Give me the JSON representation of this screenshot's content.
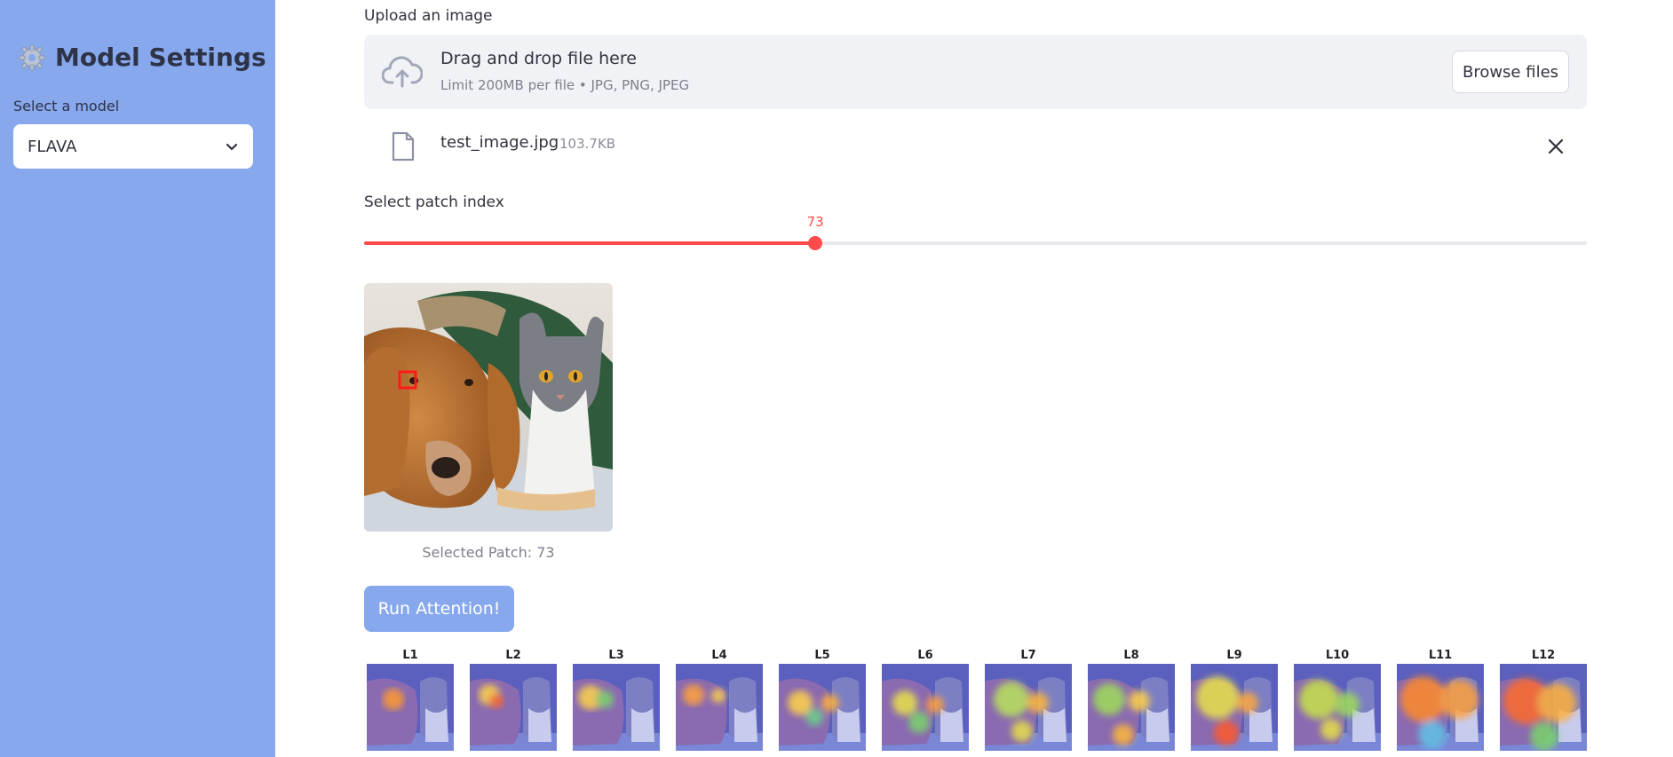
{
  "sidebar": {
    "title": "Model Settings",
    "title_icon": "gear-icon",
    "select_label": "Select a model",
    "model_value": "FLAVA"
  },
  "uploader": {
    "label": "Upload an image",
    "drop_title": "Drag and drop file here",
    "drop_sub": "Limit 200MB per file • JPG, PNG, JPEG",
    "browse_label": "Browse files",
    "file_name": "test_image.jpg",
    "file_size": "103.7KB"
  },
  "slider": {
    "label": "Select patch index",
    "value": "73",
    "fraction": 0.369
  },
  "preview": {
    "caption": "Selected Patch: 73"
  },
  "run_button": "Run Attention!",
  "layers": [
    {
      "label": "L1"
    },
    {
      "label": "L2"
    },
    {
      "label": "L3"
    },
    {
      "label": "L4"
    },
    {
      "label": "L5"
    },
    {
      "label": "L6"
    },
    {
      "label": "L7"
    },
    {
      "label": "L8"
    },
    {
      "label": "L9"
    },
    {
      "label": "L10"
    },
    {
      "label": "L11"
    },
    {
      "label": "L12"
    }
  ],
  "colors": {
    "sidebar_bg": "#87a8ec",
    "accent": "#ff4b4b",
    "button_bg": "#87a8ec"
  }
}
